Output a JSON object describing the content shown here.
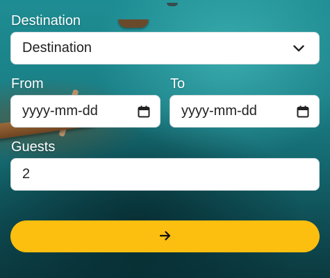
{
  "form": {
    "destination": {
      "label": "Destination",
      "selected_value": "Destination",
      "icon": "chevron-down-icon"
    },
    "from": {
      "label": "From",
      "placeholder": "yyyy-mm-dd",
      "icon": "calendar-icon"
    },
    "to": {
      "label": "To",
      "placeholder": "yyyy-mm-dd",
      "icon": "calendar-icon"
    },
    "guests": {
      "label": "Guests",
      "value": "2"
    },
    "submit": {
      "icon": "arrow-right-icon",
      "color": "#fcbf0f"
    }
  },
  "colors": {
    "label_text": "#ffffff",
    "field_bg": "#ffffff",
    "accent": "#fcbf0f"
  }
}
